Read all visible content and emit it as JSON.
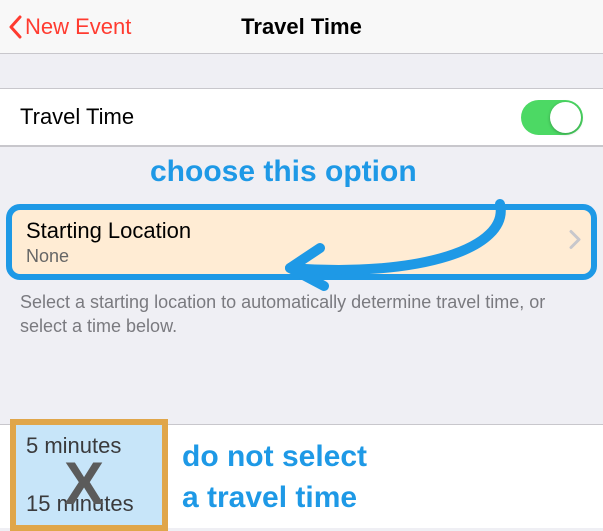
{
  "nav": {
    "back_label": "New Event",
    "title": "Travel Time"
  },
  "travel_time": {
    "label": "Travel Time",
    "enabled": true
  },
  "annotation": {
    "choose": "choose this option",
    "dont_line1": "do not select",
    "dont_line2": "a travel time",
    "x": "X"
  },
  "starting": {
    "label": "Starting Location",
    "value": "None"
  },
  "help": "Select a starting location to automatically determine travel time, or select a time below.",
  "time_options": {
    "opt1": "5 minutes",
    "opt2": "15 minutes"
  }
}
